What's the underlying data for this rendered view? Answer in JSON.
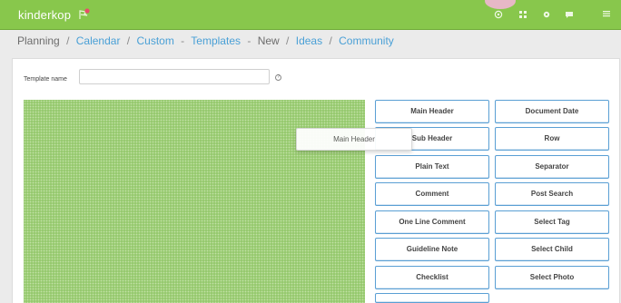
{
  "app": {
    "logo": "kinderkop"
  },
  "header": {
    "icons": [
      "globe-icon",
      "grid-icon",
      "gear-icon",
      "chat-icon",
      "menu-icon"
    ]
  },
  "breadcrumb": {
    "items": [
      {
        "label": "Planning",
        "link": false
      },
      {
        "label": "Calendar",
        "link": true
      },
      {
        "label": "Custom",
        "link": true
      },
      {
        "label": "Templates",
        "link": true
      },
      {
        "label": "New",
        "link": false
      },
      {
        "label": "Ideas",
        "link": true
      },
      {
        "label": "Community",
        "link": true
      }
    ],
    "separators": [
      "/",
      "/",
      "-",
      "-",
      "/",
      "/"
    ]
  },
  "form": {
    "template_name_label": "Template name",
    "template_name_value": "",
    "help_glyph": "?"
  },
  "palette": {
    "left": [
      "Main Header",
      "Sub Header",
      "Plain Text",
      "Comment",
      "One Line Comment",
      "Guideline Note",
      "Checklist",
      ""
    ],
    "right": [
      "Document Date",
      "Row",
      "Separator",
      "Post Search",
      "Select Tag",
      "Select Child",
      "Select Photo"
    ]
  },
  "drag": {
    "label": "Main Header"
  },
  "colors": {
    "accent": "#88c74c",
    "link": "#4aa0d6",
    "button_border": "#5a9fd4"
  }
}
